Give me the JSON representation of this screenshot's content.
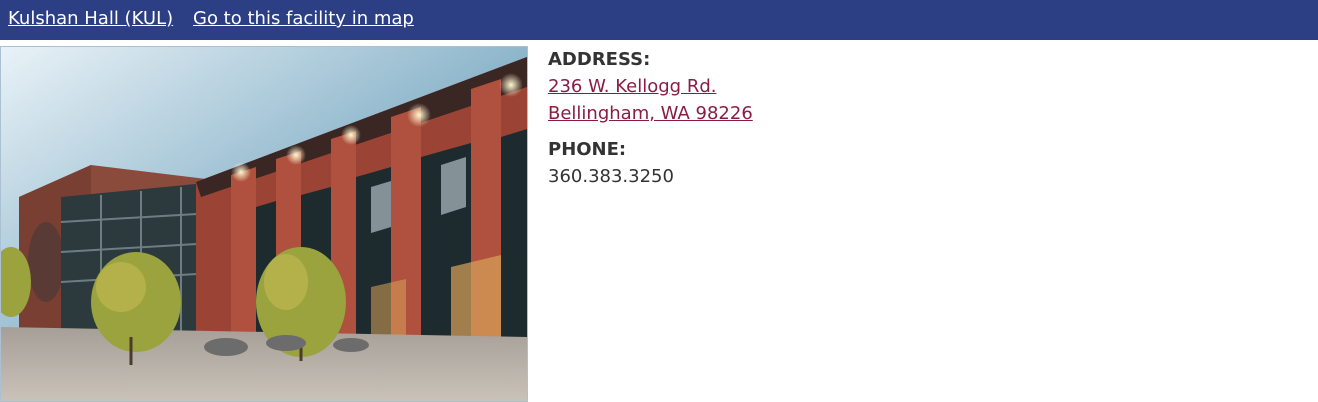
{
  "header": {
    "facility_name": "Kulshan Hall (KUL)",
    "map_link": "Go to this facility in map"
  },
  "colors": {
    "header_bg": "#2c3f85",
    "link_color": "#8a1c44",
    "text_color": "#333333"
  },
  "photo": {
    "alt": "Kulshan Hall building exterior"
  },
  "address": {
    "label": "ADDRESS:",
    "line1": "236 W. Kellogg Rd.",
    "line2": "Bellingham, WA 98226"
  },
  "phone": {
    "label": "PHONE:",
    "value": "360.383.3250"
  }
}
